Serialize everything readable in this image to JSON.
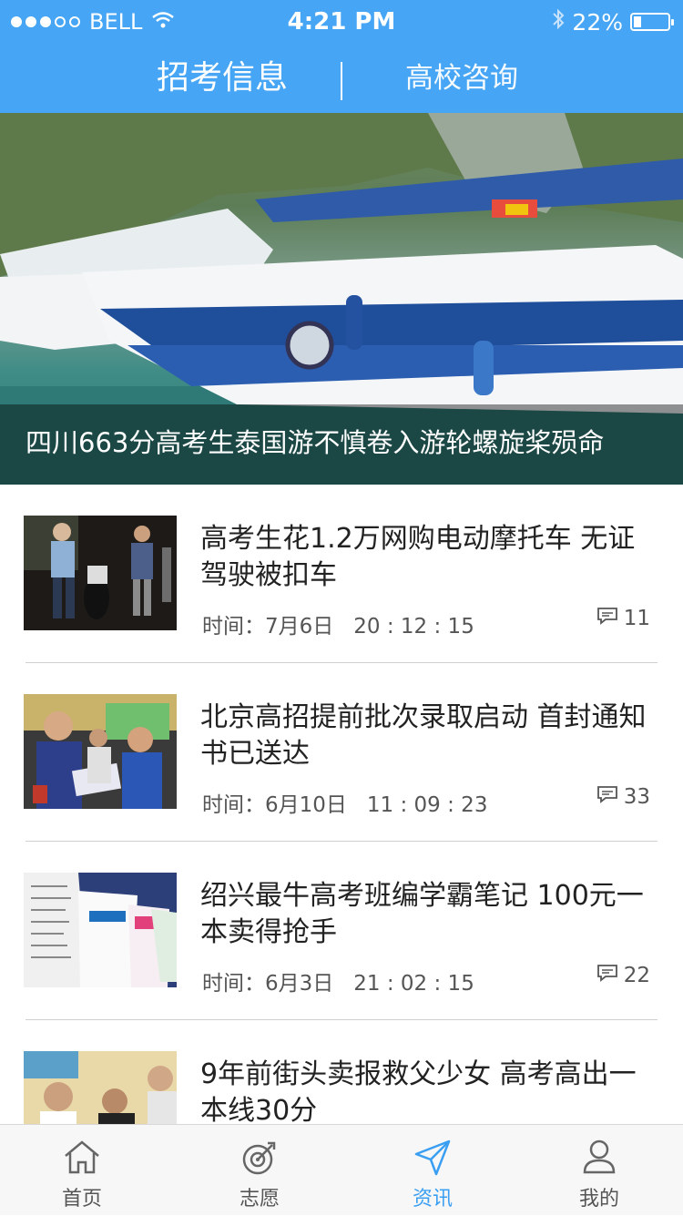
{
  "status_bar": {
    "carrier": "BELL",
    "time": "4:21 PM",
    "battery_text": "22%",
    "battery_level": 0.22
  },
  "header": {
    "tabs": [
      {
        "label": "招考信息",
        "active": true
      },
      {
        "label": "高校咨询",
        "active": false
      }
    ],
    "accent_color": "#46a5f4"
  },
  "hero": {
    "caption": "四川663分高考生泰国游不慎卷入游轮螺旋桨殒命"
  },
  "news": [
    {
      "title": "高考生花1.2万网购电动摩托车 无证驾驶被扣车",
      "date": "时间：7月6日",
      "time": "20 : 12 : 15",
      "comments": "11"
    },
    {
      "title": "北京高招提前批次录取启动 首封通知书已送达",
      "date": "时间：6月10日",
      "time": "11 : 09 : 23",
      "comments": "33"
    },
    {
      "title": "绍兴最牛高考班编学霸笔记 100元一本卖得抢手",
      "date": "时间：6月3日",
      "time": "21 : 02 : 15",
      "comments": "22"
    },
    {
      "title": "9年前街头卖报救父少女 高考高出一本线30分",
      "date": "",
      "time": "",
      "comments": ""
    }
  ],
  "tabbar": {
    "items": [
      {
        "label": "首页",
        "icon": "home-icon"
      },
      {
        "label": "志愿",
        "icon": "target-icon"
      },
      {
        "label": "资讯",
        "icon": "send-icon",
        "active": true
      },
      {
        "label": "我的",
        "icon": "user-icon"
      }
    ],
    "active_color": "#3a9ff2"
  }
}
